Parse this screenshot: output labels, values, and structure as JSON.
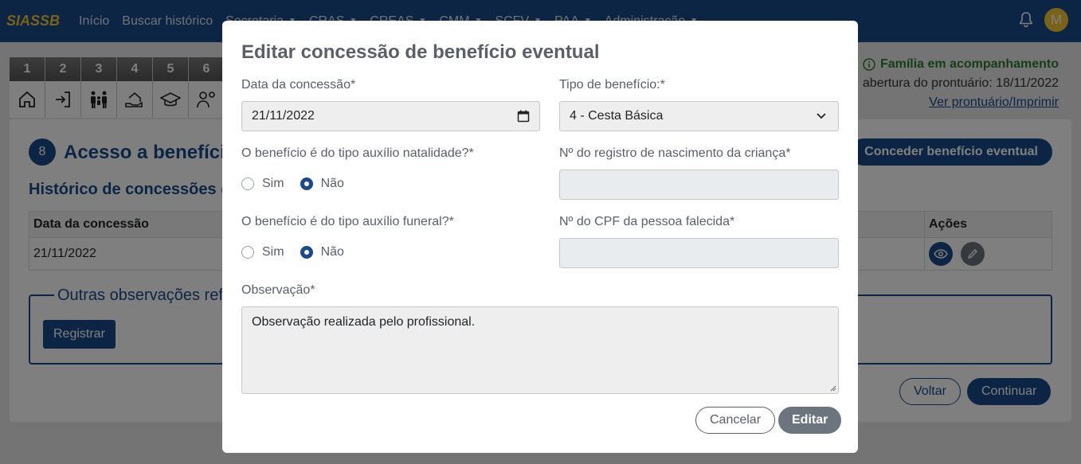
{
  "topnav": {
    "brand": "SIASSB",
    "items": [
      {
        "label": "Início",
        "has_caret": false
      },
      {
        "label": "Buscar histórico",
        "has_caret": false
      },
      {
        "label": "Secretaria",
        "has_caret": true
      },
      {
        "label": "CRAS",
        "has_caret": true
      },
      {
        "label": "CREAS",
        "has_caret": true
      },
      {
        "label": "CMM",
        "has_caret": true
      },
      {
        "label": "SCFV",
        "has_caret": true
      },
      {
        "label": "PAA",
        "has_caret": true
      },
      {
        "label": "Administração",
        "has_caret": true
      }
    ],
    "avatar_letter": "M",
    "bell_icon": "bell-icon"
  },
  "steps": [
    {
      "number": "1",
      "icon": "home-icon"
    },
    {
      "number": "2",
      "icon": "sign-in-icon"
    },
    {
      "number": "3",
      "icon": "family-icon"
    },
    {
      "number": "4",
      "icon": "house-hand-icon"
    },
    {
      "number": "5",
      "icon": "graduation-cap-icon"
    },
    {
      "number": "6",
      "icon": "worker-gear-icon"
    }
  ],
  "header_info": {
    "family_status": "Família em acompanhamento",
    "open_date": "abertura do prontuário: 18/11/2022",
    "view_link": "Ver prontuário/Imprimir"
  },
  "section": {
    "number": "8",
    "title": "Acesso a benefíci",
    "grant_button": "Conceder benefício eventual",
    "history_title": "Histórico de concessões de",
    "table": {
      "columns": [
        "Data da concessão",
        "Ações"
      ],
      "rows": [
        {
          "date": "21/11/2022"
        }
      ]
    },
    "observations_legend": "Outras observações ref",
    "register_button": "Registrar",
    "back_button": "Voltar",
    "continue_button": "Continuar"
  },
  "modal": {
    "title": "Editar concessão de benefício eventual",
    "date_label": "Data da concessão*",
    "date_value": "21/11/2022",
    "type_label": "Tipo de benefício:*",
    "type_value": "4 - Cesta Básica",
    "natality_question": "O benefício é do tipo auxílio natalidade?*",
    "natality_options": [
      "Sim",
      "Não"
    ],
    "natality_selected": "Não",
    "birth_record_label": "Nº do registro de nascimento da criança*",
    "birth_record_value": "",
    "funeral_question": "O benefício é do tipo auxílio funeral?*",
    "funeral_options": [
      "Sim",
      "Não"
    ],
    "funeral_selected": "Não",
    "cpf_label": "Nº do CPF da pessoa falecida*",
    "cpf_value": "",
    "observation_label": "Observação*",
    "observation_value": "Observação realizada pelo profissional.",
    "cancel_button": "Cancelar",
    "edit_button": "Editar"
  },
  "colors": {
    "primary": "#1a4a8a",
    "brand_yellow": "#f4c430",
    "success": "#2e7d32",
    "secondary": "#6c757d"
  }
}
